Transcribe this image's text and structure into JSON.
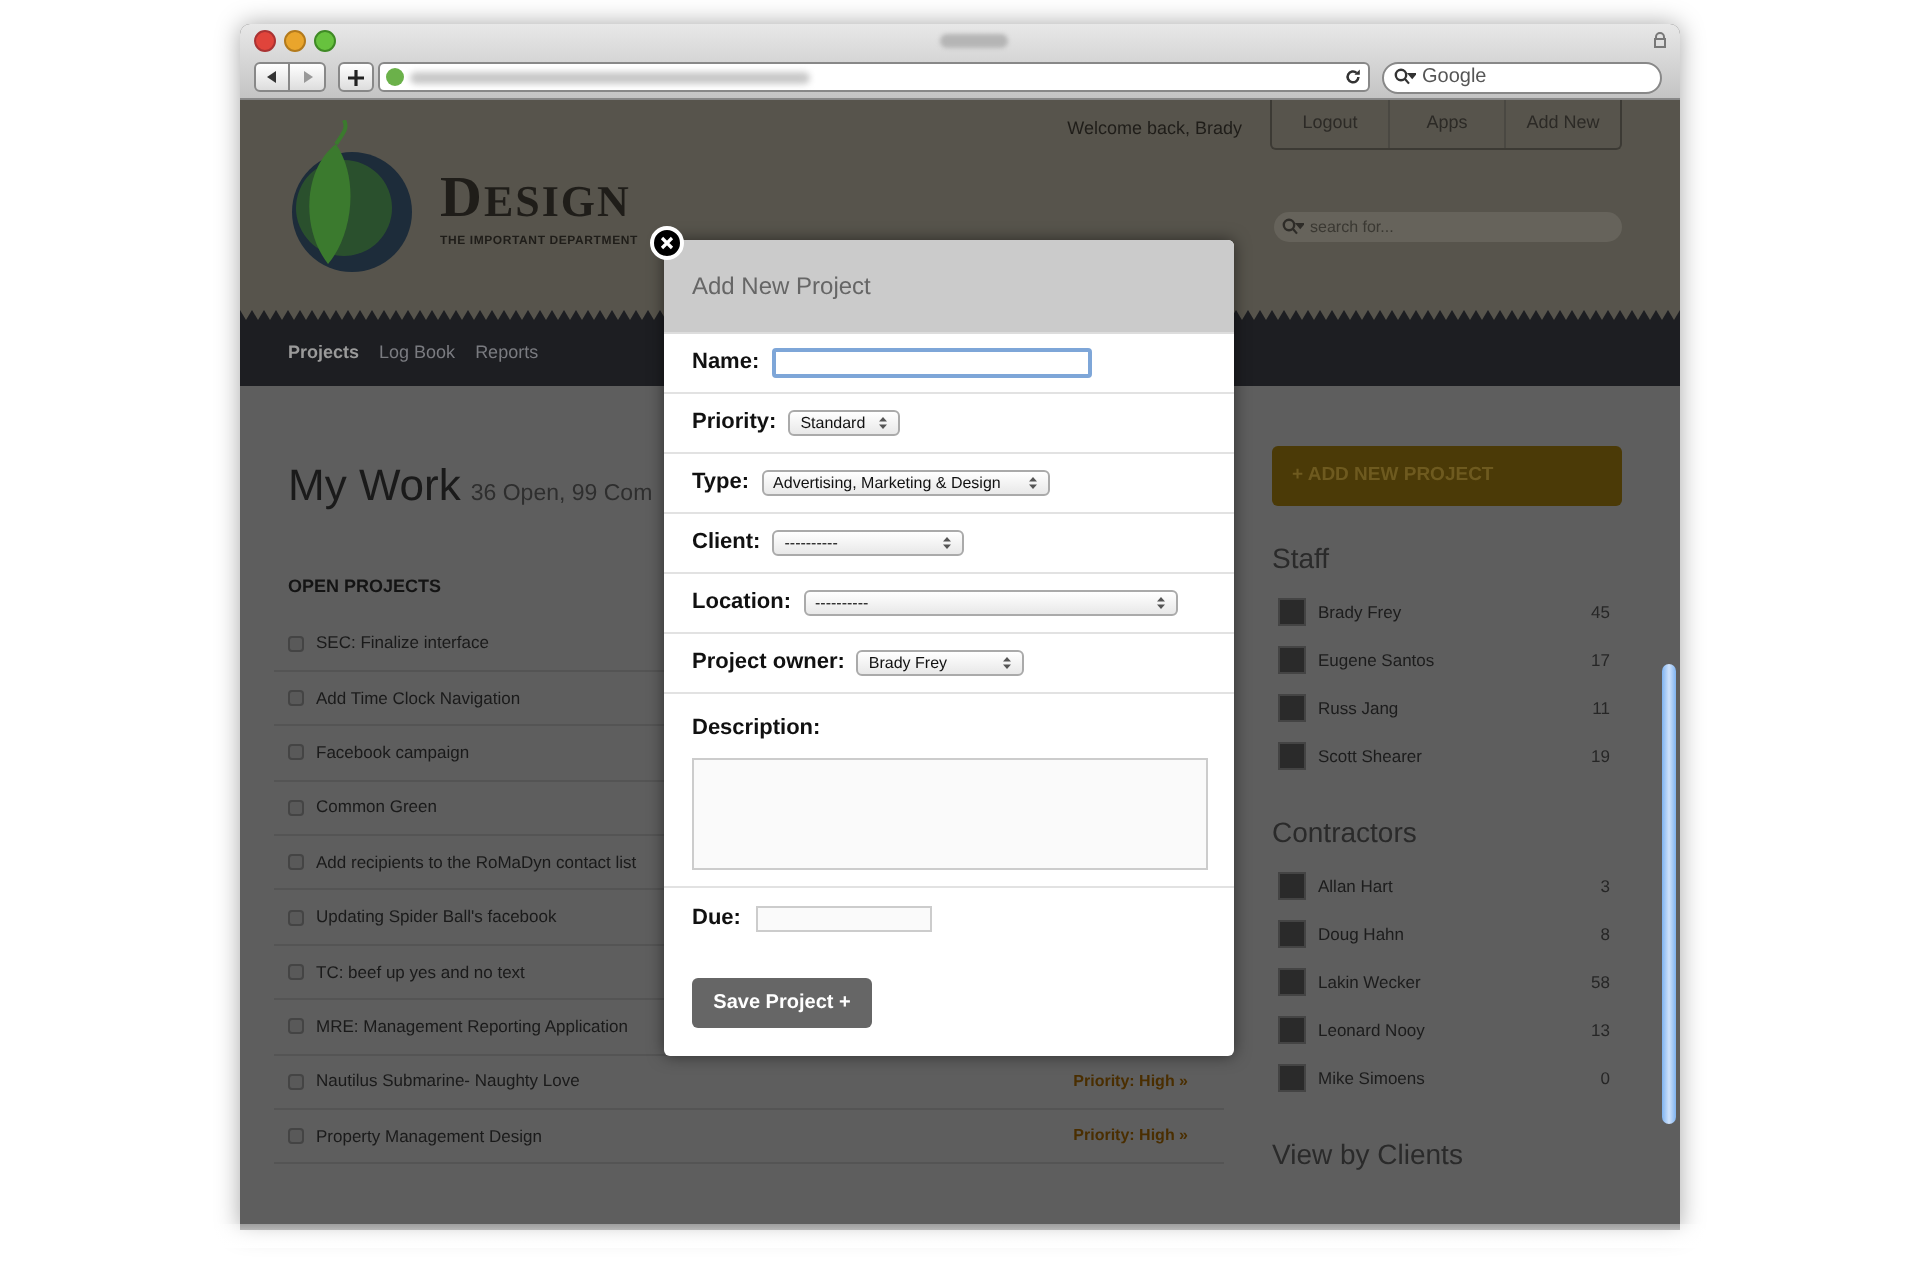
{
  "browser": {
    "search_placeholder": "Google"
  },
  "header": {
    "welcome": "Welcome back, Brady",
    "buttons": [
      "Logout",
      "Apps",
      "Add New"
    ],
    "logo_title": "DESIGN",
    "logo_tagline": "THE IMPORTANT DEPARTMENT",
    "search_placeholder": "search for..."
  },
  "nav": [
    {
      "label": "Projects",
      "selected": true
    },
    {
      "label": "Log Book",
      "selected": false
    },
    {
      "label": "Reports",
      "selected": false
    }
  ],
  "main": {
    "title": "My Work",
    "summary": "36 Open, 99 Com",
    "section": "OPEN PROJECTS",
    "projects": [
      {
        "name": "SEC: Finalize interface",
        "checked": false
      },
      {
        "name": "Add Time Clock Navigation",
        "checked": false
      },
      {
        "name": "Facebook campaign",
        "checked": false
      },
      {
        "name": "Common Green",
        "checked": false
      },
      {
        "name": "Add recipients to the RoMaDyn contact list",
        "checked": false
      },
      {
        "name": "Updating Spider Ball's facebook",
        "checked": false
      },
      {
        "name": "TC: beef up yes and no text",
        "checked": false
      },
      {
        "name": "MRE: Management Reporting Application",
        "checked": false
      },
      {
        "name": "Nautilus Submarine- Naughty Love",
        "checked": false,
        "priority": "Priority: High »"
      },
      {
        "name": "Property Management Design",
        "checked": false,
        "priority": "Priority: High »"
      }
    ]
  },
  "sidebar": {
    "add_button": "+ ADD NEW PROJECT",
    "groups": [
      {
        "title": "Staff",
        "people": [
          {
            "name": "Brady Frey",
            "count": "45"
          },
          {
            "name": "Eugene Santos",
            "count": "17"
          },
          {
            "name": "Russ Jang",
            "count": "11"
          },
          {
            "name": "Scott Shearer",
            "count": "19"
          }
        ]
      },
      {
        "title": "Contractors",
        "people": [
          {
            "name": "Allan Hart",
            "count": "3"
          },
          {
            "name": "Doug Hahn",
            "count": "8"
          },
          {
            "name": "Lakin Wecker",
            "count": "58"
          },
          {
            "name": "Leonard Nooy",
            "count": "13"
          },
          {
            "name": "Mike Simoens",
            "count": "0"
          }
        ]
      },
      {
        "title": "View by Clients"
      }
    ]
  },
  "modal": {
    "title": "Add New Project",
    "fields": [
      {
        "kind": "text",
        "label": "Name:",
        "focused": true
      },
      {
        "kind": "select",
        "label": "Priority:",
        "value": "Standard"
      },
      {
        "kind": "select",
        "label": "Type:",
        "value": "Advertising, Marketing & Design"
      },
      {
        "kind": "select",
        "label": "Client:",
        "value": "----------"
      },
      {
        "kind": "select",
        "label": "Location:",
        "value": "----------"
      },
      {
        "kind": "select",
        "label": "Project owner:",
        "value": "Brady Frey"
      },
      {
        "kind": "textarea",
        "label": "Description:"
      },
      {
        "kind": "date",
        "label": "Due:"
      }
    ],
    "submit": "Save Project +"
  }
}
